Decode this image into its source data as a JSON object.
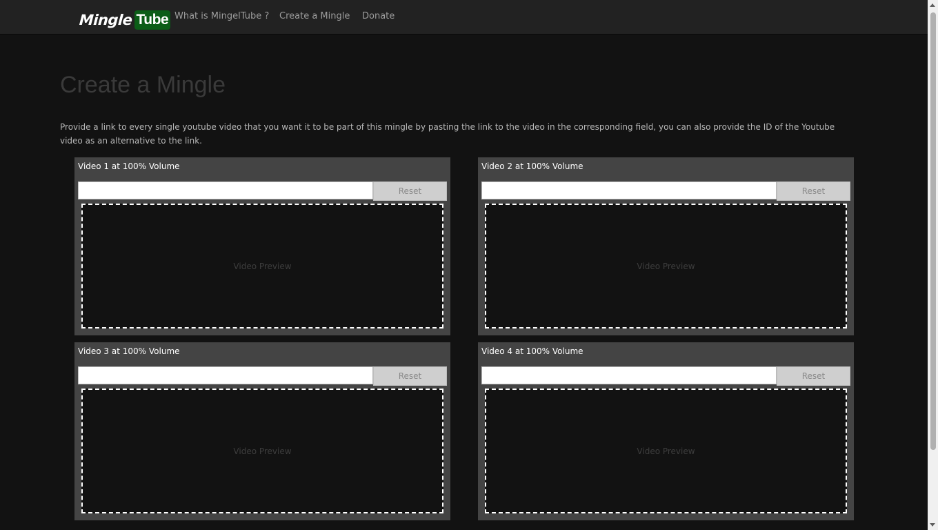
{
  "brand": {
    "part1": "Mingle",
    "part2": "Tube"
  },
  "nav": [
    {
      "label": "What is MingelTube ?"
    },
    {
      "label": "Create a Mingle"
    },
    {
      "label": "Donate"
    }
  ],
  "page": {
    "title": "Create a Mingle",
    "intro": "Provide a link to every single youtube video that you want it to be part of this mingle by pasting the link to the video in the corresponding field, you can also provide the ID of the Youtube video as an alternative to the link."
  },
  "videos": [
    {
      "title": "Video 1 at 100% Volume",
      "value": "",
      "reset_label": "Reset",
      "preview_label": "Video Preview"
    },
    {
      "title": "Video 2 at 100% Volume",
      "value": "",
      "reset_label": "Reset",
      "preview_label": "Video Preview"
    },
    {
      "title": "Video 3 at 100% Volume",
      "value": "",
      "reset_label": "Reset",
      "preview_label": "Video Preview"
    },
    {
      "title": "Video 4 at 100% Volume",
      "value": "",
      "reset_label": "Reset",
      "preview_label": "Video Preview"
    }
  ],
  "colors": {
    "background": "#121212",
    "navbar": "#222222",
    "panel": "#444444",
    "brand_accent": "#0b5d17"
  }
}
